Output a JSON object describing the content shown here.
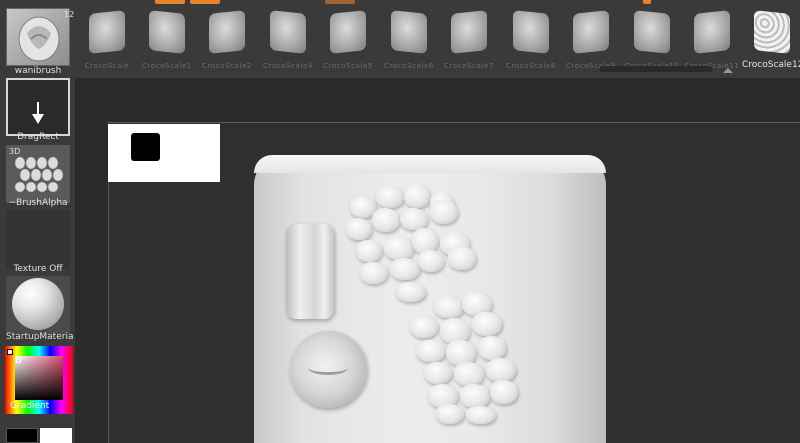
{
  "shelf": {
    "brush": {
      "label": "wanibrush",
      "badge": "12"
    },
    "stroke": {
      "label": "DragRect"
    },
    "alpha": {
      "label": "~BrushAlpha",
      "badge": "3D"
    },
    "texture": {
      "label": "Texture Off"
    },
    "material": {
      "label": "StartupMateria"
    },
    "color": {
      "label": "Gradient",
      "main_color": "#000000",
      "secondary_color": "#ffffff"
    }
  },
  "brush_strip": {
    "items": [
      {
        "label": "CrocoScale"
      },
      {
        "label": "CrocoScale1"
      },
      {
        "label": "CrocoScale2"
      },
      {
        "label": "CrocoScale4"
      },
      {
        "label": "CrocoScale5"
      },
      {
        "label": "CrocoScale6"
      },
      {
        "label": "CrocoScale7"
      },
      {
        "label": "CrocoScale8"
      },
      {
        "label": "CrocoScale9"
      },
      {
        "label": "CrocoScale10"
      },
      {
        "label": "CrocoScale11"
      },
      {
        "label": "CrocoScale12"
      }
    ],
    "selected_index": 11
  },
  "colors": {
    "accent_orange": "#e8822c",
    "panel_bg": "#3a3a3a",
    "canvas_bg": "#2b2b2b"
  }
}
